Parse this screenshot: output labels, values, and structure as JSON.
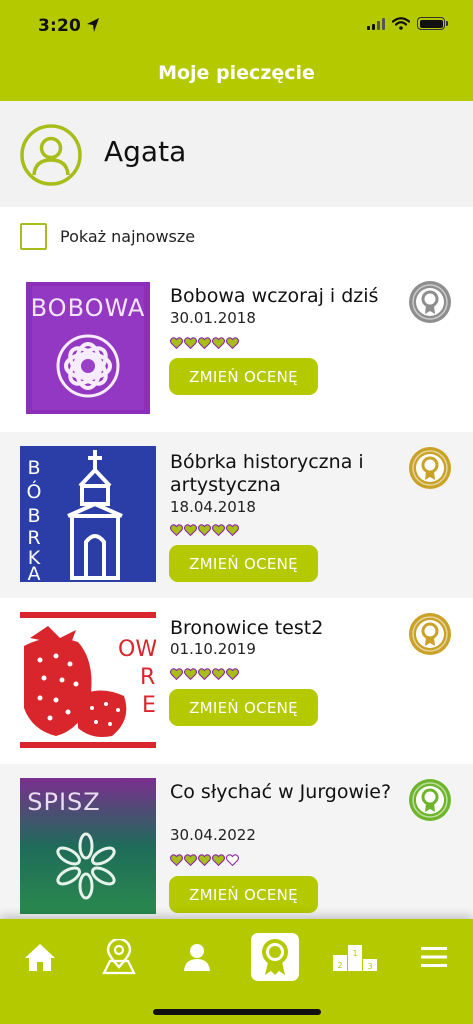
{
  "status_bar": {
    "time": "3:20"
  },
  "header": {
    "title": "Moje pieczęcie"
  },
  "user": {
    "name": "Agata"
  },
  "filter": {
    "label": "Pokaż najnowsze",
    "checked": false
  },
  "stamps": [
    {
      "title": "Bobowa wczoraj i dziś",
      "date": "30.01.2018",
      "rating": 5,
      "button_label": "ZMIEŃ OCENĘ",
      "badge_color": "#8e8e8e",
      "stamp_text": "BOBOWA"
    },
    {
      "title": "Bóbrka historyczna i artystyczna",
      "date": "18.04.2018",
      "rating": 5,
      "button_label": "ZMIEŃ OCENĘ",
      "badge_color": "#c9a227",
      "stamp_text": "BÓBRKA"
    },
    {
      "title": "Bronowice test2",
      "date": "01.10.2019",
      "rating": 5,
      "button_label": "ZMIEŃ OCENĘ",
      "badge_color": "#c9a227",
      "stamp_text": "OWO R E"
    },
    {
      "title": "Co słychać w Jurgowie?",
      "date": "30.04.2022",
      "rating": 4,
      "button_label": "ZMIEŃ OCENĘ",
      "badge_color": "#6fb52c",
      "stamp_text": "SPISZ"
    }
  ],
  "colors": {
    "accent": "#b5c900",
    "heart_fill": "#a8bd1a",
    "heart_stroke": "#8a2a9e"
  },
  "bottom_nav": [
    {
      "icon": "home-icon"
    },
    {
      "icon": "map-pin-icon"
    },
    {
      "icon": "user-icon"
    },
    {
      "icon": "stamp-badge-icon",
      "active": true
    },
    {
      "icon": "podium-icon",
      "podium_labels": [
        "2",
        "1",
        "3"
      ]
    },
    {
      "icon": "menu-icon"
    }
  ]
}
